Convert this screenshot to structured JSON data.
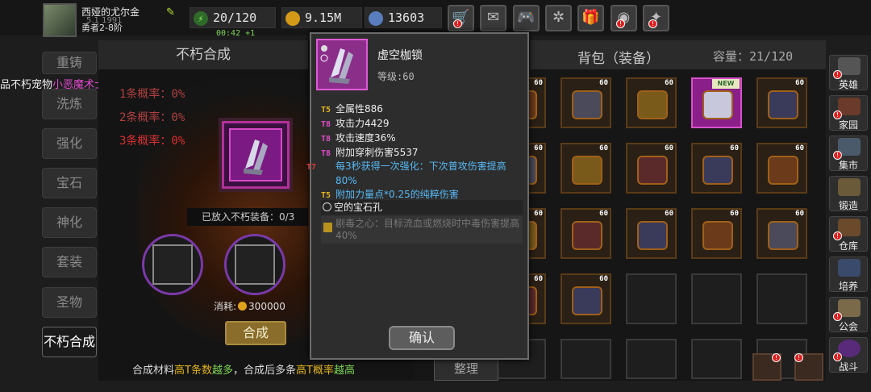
{
  "player": {
    "name": "西娅的尤尔金",
    "rank": "勇者2-8阶",
    "rank_sub": "5.1 1991"
  },
  "resources": [
    {
      "name": "stamina",
      "value": "20/120"
    },
    {
      "name": "gold",
      "value": "9.15M"
    },
    {
      "name": "gems",
      "value": "13603"
    }
  ],
  "timer": "00:42 +1",
  "top_buttons": [
    "shop-icon",
    "mail-icon",
    "gamepad-icon",
    "settings-icon",
    "gift-icon",
    "wheel-icon",
    "event-icon"
  ],
  "left_menu": {
    "items": [
      "重铸",
      "洗炼",
      "强化",
      "宝石",
      "神化",
      "套装",
      "圣物",
      "不朽合成"
    ],
    "active": "不朽合成"
  },
  "pet_text": {
    "prefix": "品不朽宠物",
    "name": "小恶魔术士"
  },
  "immortal": {
    "title": "不朽合成",
    "chances": [
      "1条概率：0%",
      "2条概率：0%",
      "3条概率：0%"
    ],
    "placed_label": "已放入不朽装备：0/3",
    "cost_label": "消耗:",
    "cost_value": "300000",
    "synth_button": "合成",
    "hint": {
      "a": "合成材料",
      "b": "高T条数",
      "c": "越多",
      "d": "，合成后多条",
      "e": "高T概率",
      "f": "越高"
    }
  },
  "bag": {
    "title": "背包（装备）",
    "capacity": "容量：21/120",
    "sort_button": "整理",
    "new_tag": "NEW",
    "level": "60"
  },
  "right_sidebar": [
    {
      "label": "英雄",
      "icon": "hero-icon"
    },
    {
      "label": "家园",
      "icon": "home-icon"
    },
    {
      "label": "集市",
      "icon": "market-icon"
    },
    {
      "label": "锻造",
      "icon": "anvil-icon"
    },
    {
      "label": "仓库",
      "icon": "warehouse-icon"
    },
    {
      "label": "培养",
      "icon": "train-icon"
    },
    {
      "label": "公会",
      "icon": "guild-icon"
    },
    {
      "label": "战斗",
      "icon": "battle-icon"
    }
  ],
  "tooltip": {
    "item_name": "虚空枷锁",
    "level": "等级:60",
    "stats": [
      {
        "tier": "T5",
        "text": "全属性886",
        "tier_color": "#e2b51f",
        "blue": false
      },
      {
        "tier": "T8",
        "text": "攻击力4429",
        "tier_color": "#e14cc8",
        "blue": false
      },
      {
        "tier": "T8",
        "text": "攻击速度36%",
        "tier_color": "#e14cc8",
        "blue": false
      },
      {
        "tier": "T8",
        "text": "附加穿刺伤害5537",
        "tier_color": "#e14cc8",
        "blue": false
      },
      {
        "tier": "T7",
        "text": "每3秒获得一次强化：下次普攻伤害提高80%",
        "tier_color": "#d83a3a",
        "blue": true
      },
      {
        "tier": "T5",
        "text": "附加力量点*0.25的纯粹伤害",
        "tier_color": "#e2b51f",
        "blue": true
      }
    ],
    "gem_slot": "空的宝石孔",
    "set_desc": "剧毒之心：目标流血或燃烧时中毒伤害提高40%",
    "confirm_button": "确认"
  }
}
